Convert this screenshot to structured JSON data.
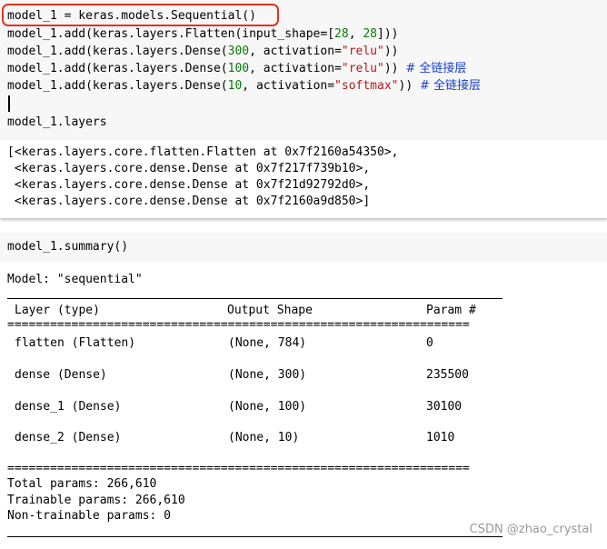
{
  "cell1": {
    "lines": [
      "model_1 = keras.models.Sequential()",
      "model_1.add(keras.layers.Flatten(input_shape=[28, 28]))",
      "model_1.add(keras.layers.Dense(300, activation=\"relu\"))",
      "model_1.add(keras.layers.Dense(100, activation=\"relu\")) # 全链接层",
      "model_1.add(keras.layers.Dense(10, activation=\"softmax\")) # 全链接层"
    ]
  },
  "cell2": {
    "input": "model_1.layers",
    "output": [
      "[<keras.layers.core.flatten.Flatten at 0x7f2160a54350>,",
      " <keras.layers.core.dense.Dense at 0x7f217f739b10>,",
      " <keras.layers.core.dense.Dense at 0x7f21d92792d0>,",
      " <keras.layers.core.dense.Dense at 0x7f2160a9d850>]"
    ]
  },
  "cell3": {
    "input": "model_1.summary()",
    "model_line": "Model: \"sequential\"",
    "header": {
      "layer": "Layer (type)",
      "shape": "Output Shape",
      "params": "Param #"
    },
    "rows": [
      {
        "layer": "flatten (Flatten)",
        "shape": "(None, 784)",
        "params": "0"
      },
      {
        "layer": "dense (Dense)",
        "shape": "(None, 300)",
        "params": "235500"
      },
      {
        "layer": "dense_1 (Dense)",
        "shape": "(None, 100)",
        "params": "30100"
      },
      {
        "layer": "dense_2 (Dense)",
        "shape": "(None, 10)",
        "params": "1010"
      }
    ],
    "double_rule": "=================================================================",
    "totals": [
      "Total params: 266,610",
      "Trainable params: 266,610",
      "Non-trainable params: 0"
    ]
  },
  "watermark": "CSDN @zhao_crystal",
  "colors": {
    "highlight": "#e2331f",
    "number": "#0a7a0a",
    "string": "#b11a1a",
    "comment": "#1a3fd0"
  }
}
